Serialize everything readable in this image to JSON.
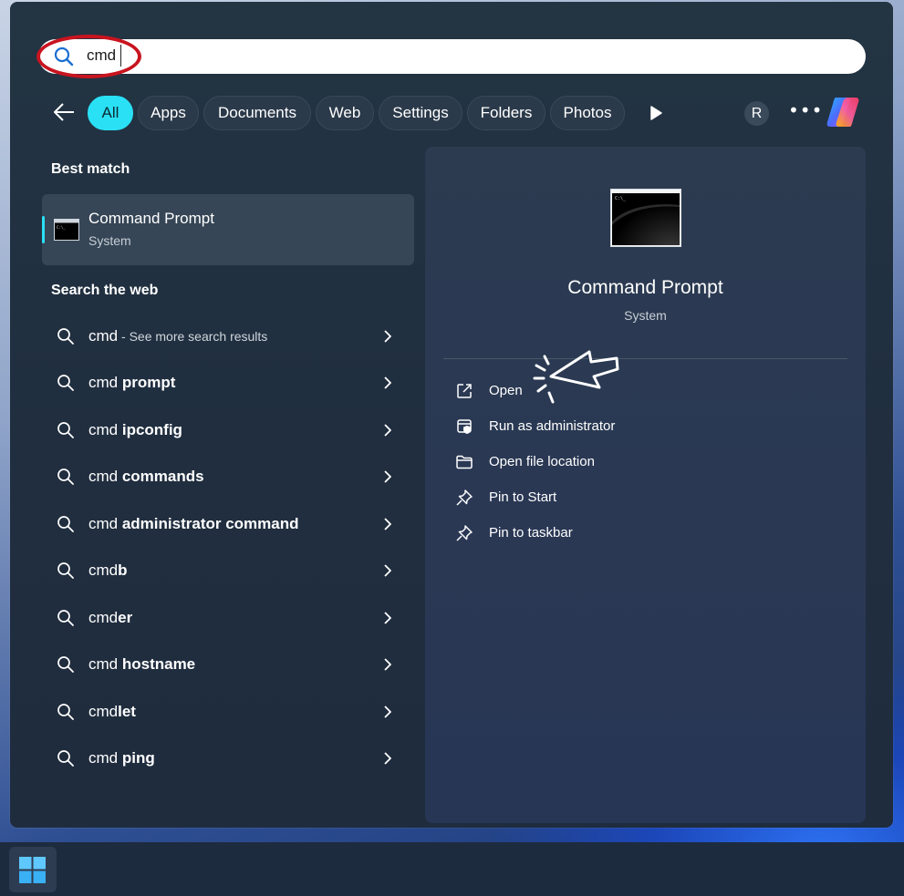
{
  "search": {
    "query": "cmd"
  },
  "filters": [
    "All",
    "Apps",
    "Documents",
    "Web",
    "Settings",
    "Folders",
    "Photos"
  ],
  "profile_initial": "R",
  "more_label": "•••",
  "best_match": {
    "heading": "Best match",
    "title": "Command Prompt",
    "subtitle": "System"
  },
  "web": {
    "heading": "Search the web",
    "items": [
      {
        "prefix": "cmd",
        "bold": "",
        "note": " - See more search results"
      },
      {
        "prefix": "cmd ",
        "bold": "prompt",
        "note": ""
      },
      {
        "prefix": "cmd ",
        "bold": "ipconfig",
        "note": ""
      },
      {
        "prefix": "cmd ",
        "bold": "commands",
        "note": ""
      },
      {
        "prefix": "cmd ",
        "bold": "administrator command",
        "note": ""
      },
      {
        "prefix": "cmd",
        "bold": "b",
        "note": ""
      },
      {
        "prefix": "cmd",
        "bold": "er",
        "note": ""
      },
      {
        "prefix": "cmd ",
        "bold": "hostname",
        "note": ""
      },
      {
        "prefix": "cmd",
        "bold": "let",
        "note": ""
      },
      {
        "prefix": "cmd ",
        "bold": "ping",
        "note": ""
      }
    ]
  },
  "detail": {
    "title": "Command Prompt",
    "subtitle": "System",
    "actions": [
      {
        "label": "Open",
        "icon": "open-external-icon"
      },
      {
        "label": "Run as administrator",
        "icon": "shield-window-icon"
      },
      {
        "label": "Open file location",
        "icon": "folder-icon"
      },
      {
        "label": "Pin to Start",
        "icon": "pin-icon"
      },
      {
        "label": "Pin to taskbar",
        "icon": "pin-icon"
      }
    ]
  },
  "colors": {
    "accent": "#2ae0f5",
    "highlight_ring": "#c8141f"
  }
}
